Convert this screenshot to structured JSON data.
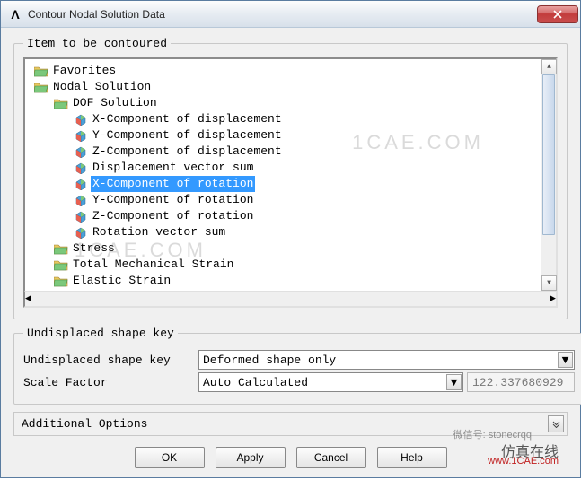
{
  "window": {
    "title": "Contour Nodal Solution Data"
  },
  "groupbox": {
    "title": "Item to be contoured"
  },
  "tree": {
    "nodes": [
      {
        "label": "Favorites",
        "indent": 0,
        "icon": "folder"
      },
      {
        "label": "Nodal Solution",
        "indent": 0,
        "icon": "folder-open"
      },
      {
        "label": "DOF Solution",
        "indent": 1,
        "icon": "folder-open"
      },
      {
        "label": "X-Component of displacement",
        "indent": 2,
        "icon": "result"
      },
      {
        "label": "Y-Component of displacement",
        "indent": 2,
        "icon": "result"
      },
      {
        "label": "Z-Component of displacement",
        "indent": 2,
        "icon": "result"
      },
      {
        "label": "Displacement vector sum",
        "indent": 2,
        "icon": "result"
      },
      {
        "label": "X-Component of rotation",
        "indent": 2,
        "icon": "result",
        "selected": true
      },
      {
        "label": "Y-Component of rotation",
        "indent": 2,
        "icon": "result"
      },
      {
        "label": "Z-Component of rotation",
        "indent": 2,
        "icon": "result"
      },
      {
        "label": "Rotation vector sum",
        "indent": 2,
        "icon": "result"
      },
      {
        "label": "Stress",
        "indent": 1,
        "icon": "folder"
      },
      {
        "label": "Total Mechanical Strain",
        "indent": 1,
        "icon": "folder"
      },
      {
        "label": "Elastic Strain",
        "indent": 1,
        "icon": "folder"
      }
    ]
  },
  "undisplaced": {
    "title": "Undisplaced shape key",
    "shape_label": "Undisplaced shape key",
    "shape_value": "Deformed shape only",
    "scale_label": "Scale Factor",
    "scale_value": "Auto Calculated",
    "scale_number": "122.337680929"
  },
  "additional": {
    "label": "Additional Options"
  },
  "buttons": {
    "ok": "OK",
    "apply": "Apply",
    "cancel": "Cancel",
    "help": "Help"
  },
  "watermarks": {
    "w1": "1CAE.COM",
    "w2": "1CAE.COM",
    "w3": "微信号: stonecrqq",
    "w4": "仿真在线",
    "w5": "www.1CAE.com"
  }
}
